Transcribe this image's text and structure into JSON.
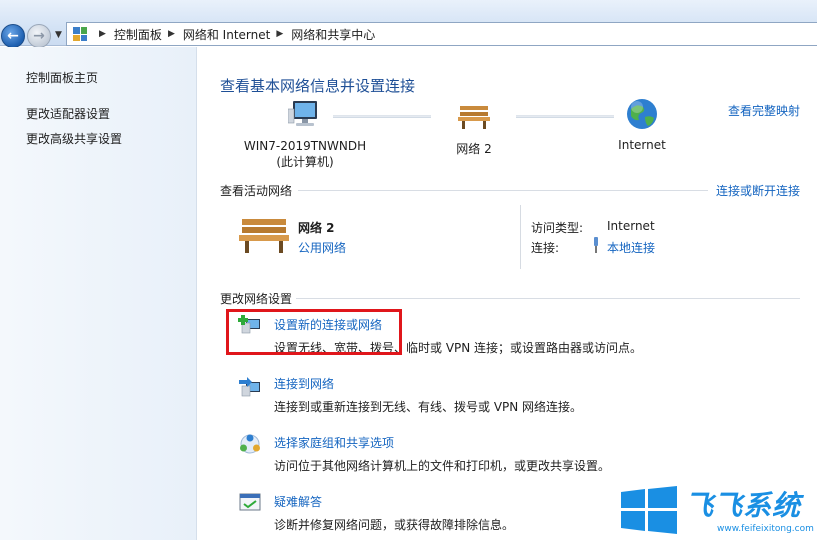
{
  "breadcrumb": {
    "items": [
      "控制面板",
      "网络和 Internet",
      "网络和共享中心"
    ]
  },
  "left_pane": {
    "links": [
      "控制面板主页",
      "更改适配器设置",
      "更改高级共享设置"
    ]
  },
  "main": {
    "title": "查看基本网络信息并设置连接",
    "full_map_link": "查看完整映射",
    "map": {
      "computer_name": "WIN7-2019TNWNDH",
      "computer_sub": "(此计算机)",
      "network_name": "网络  2",
      "internet_label": "Internet"
    },
    "active_networks": {
      "heading": "查看活动网络",
      "connect_link": "连接或断开连接",
      "network_name": "网络  2",
      "network_type": "公用网络",
      "access_type_label": "访问类型:",
      "access_type_value": "Internet",
      "connection_label": "连接:",
      "connection_value": "本地连接"
    },
    "change_settings": {
      "heading": "更改网络设置",
      "tasks": [
        {
          "title": "设置新的连接或网络",
          "desc": "设置无线、宽带、拨号、临时或 VPN 连接；或设置路由器或访问点。",
          "icon": "new-connection-icon"
        },
        {
          "title": "连接到网络",
          "desc": "连接到或重新连接到无线、有线、拨号或 VPN 网络连接。",
          "icon": "connect-network-icon"
        },
        {
          "title": "选择家庭组和共享选项",
          "desc": "访问位于其他网络计算机上的文件和打印机，或更改共享设置。",
          "icon": "homegroup-icon"
        },
        {
          "title": "疑难解答",
          "desc": "诊断并修复网络问题，或获得故障排除信息。",
          "icon": "troubleshoot-icon"
        }
      ]
    }
  },
  "watermark": {
    "brand": "飞飞系统",
    "url": "www.feifeixitong.com"
  },
  "colors": {
    "link": "#1565c0",
    "title": "#1e4f96",
    "highlight": "#e0161b"
  }
}
